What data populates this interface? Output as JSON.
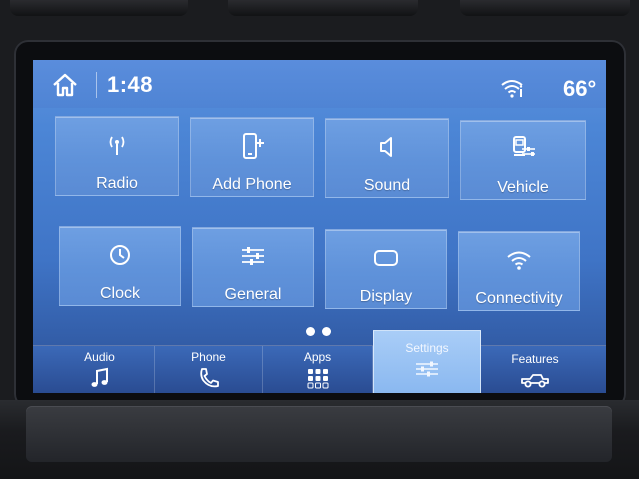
{
  "status": {
    "time": "1:48",
    "temperature": "66°"
  },
  "tiles": [
    {
      "label": "Radio",
      "icon": "radio-tower-icon"
    },
    {
      "label": "Add Phone",
      "icon": "add-phone-icon"
    },
    {
      "label": "Sound",
      "icon": "speaker-icon"
    },
    {
      "label": "Vehicle",
      "icon": "vehicle-settings-icon"
    },
    {
      "label": "Clock",
      "icon": "clock-icon"
    },
    {
      "label": "General",
      "icon": "sliders-icon"
    },
    {
      "label": "Display",
      "icon": "display-icon"
    },
    {
      "label": "Connectivity",
      "icon": "wifi-icon"
    }
  ],
  "nav": [
    {
      "label": "Audio",
      "icon": "music-note-icon"
    },
    {
      "label": "Phone",
      "icon": "phone-icon"
    },
    {
      "label": "Apps",
      "icon": "apps-grid-icon"
    },
    {
      "label": "Settings",
      "icon": "settings-sliders-icon",
      "active": true
    },
    {
      "label": "Features",
      "icon": "truck-icon"
    }
  ],
  "colors": {
    "screen_top": "#5f93de",
    "screen_bottom": "#2b4f95",
    "active_tab": "#9ec5f5"
  }
}
